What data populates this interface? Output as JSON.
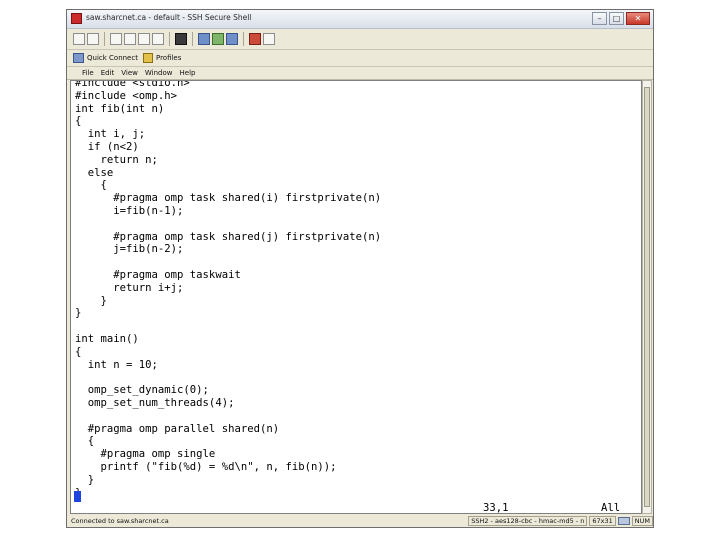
{
  "window": {
    "title": "saw.sharcnet.ca - default - SSH Secure Shell"
  },
  "toolbar": {
    "quick_connect": "Quick Connect",
    "profiles": "Profiles"
  },
  "menu": [
    "File",
    "Edit",
    "View",
    "Window",
    "Help"
  ],
  "terminal": {
    "lines": [
      "#include <stdio.h>",
      "#include <omp.h>",
      "int fib(int n)",
      "{",
      "  int i, j;",
      "  if (n<2)",
      "    return n;",
      "  else",
      "    {",
      "      #pragma omp task shared(i) firstprivate(n)",
      "      i=fib(n-1);",
      "",
      "      #pragma omp task shared(j) firstprivate(n)",
      "      j=fib(n-2);",
      "",
      "      #pragma omp taskwait",
      "      return i+j;",
      "    }",
      "}",
      "",
      "int main()",
      "{",
      "  int n = 10;",
      "",
      "  omp_set_dynamic(0);",
      "  omp_set_num_threads(4);",
      "",
      "  #pragma omp parallel shared(n)",
      "  {",
      "    #pragma omp single",
      "    printf (\"fib(%d) = %d\\n\", n, fib(n));",
      "  }",
      "}"
    ],
    "position": "33,1",
    "scroll_state": "All"
  },
  "statusbar": {
    "connection": "Connected to saw.sharcnet.ca",
    "protocol": "SSH2 - aes128-cbc - hmac-md5 - n",
    "size": "67x31",
    "num": "NUM"
  }
}
